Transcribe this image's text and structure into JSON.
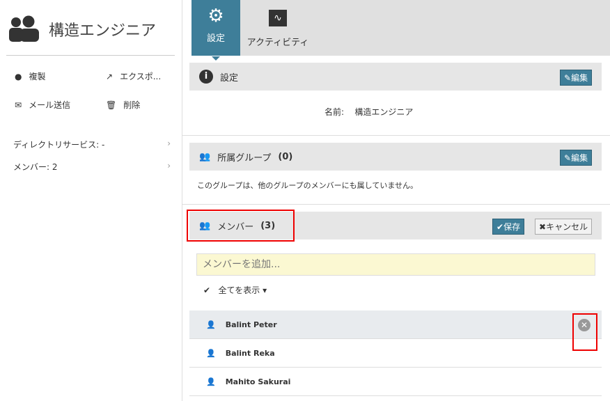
{
  "sidebar": {
    "title": "構造エンジニア",
    "actions": {
      "duplicate": "複製",
      "export": "エクスポ...",
      "email": "メール送信",
      "delete": "削除"
    },
    "nav": [
      {
        "label": "ディレクトリサービス: -"
      },
      {
        "label": "メンバー: 2"
      }
    ]
  },
  "tabs": [
    {
      "label": "設定"
    },
    {
      "label": "アクティビティ"
    }
  ],
  "settings": {
    "header": "設定",
    "edit": "編集",
    "name_label": "名前:",
    "name_value": "構造エンジニア"
  },
  "groups": {
    "header": "所属グループ",
    "count": "(0)",
    "edit": "編集",
    "message": "このグループは、他のグループのメンバーにも属していません。"
  },
  "members": {
    "header": "メンバー",
    "count": "(3)",
    "save": "保存",
    "cancel": "キャンセル",
    "add_placeholder": "メンバーを追加...",
    "show_all": "全てを表示",
    "list": [
      {
        "name": "Balint Peter"
      },
      {
        "name": "Balint Reka"
      },
      {
        "name": "Mahito Sakurai"
      }
    ]
  }
}
